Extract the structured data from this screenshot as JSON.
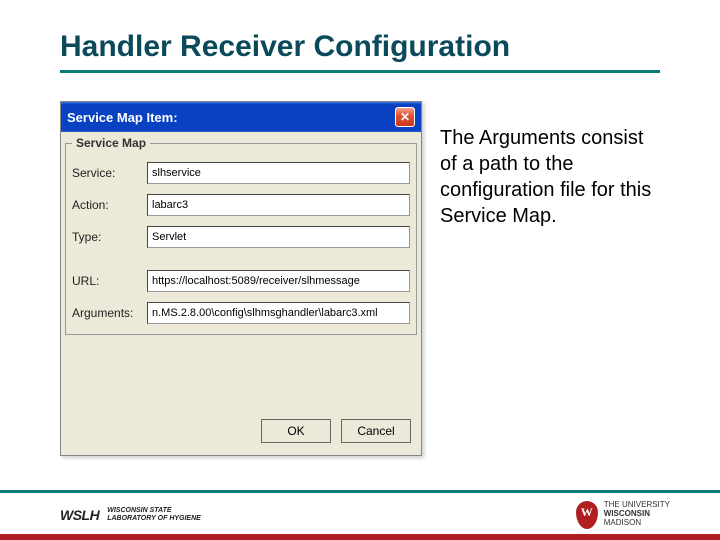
{
  "title": "Handler Receiver Configuration",
  "dialog": {
    "titlebar": "Service Map Item:",
    "legend": "Service Map",
    "labels": {
      "service": "Service:",
      "action": "Action:",
      "type": "Type:",
      "url": "URL:",
      "arguments": "Arguments:"
    },
    "values": {
      "service": "slhservice",
      "action": "labarc3",
      "type": "Servlet",
      "url": "https://localhost:5089/receiver/slhmessage",
      "arguments": "n.MS.2.8.00\\config\\slhmsghandler\\labarc3.xml"
    },
    "buttons": {
      "ok": "OK",
      "cancel": "Cancel"
    }
  },
  "note": "The Arguments consist of a path to the configuration file for this Service Map.",
  "footer": {
    "wslh_logo": "WSLH",
    "wslh_line1": "WISCONSIN STATE",
    "wslh_line2": "LABORATORY OF HYGIENE",
    "uw_line1": "THE UNIVERSITY",
    "uw_line2": "WISCONSIN",
    "uw_line3": "MADISON"
  }
}
